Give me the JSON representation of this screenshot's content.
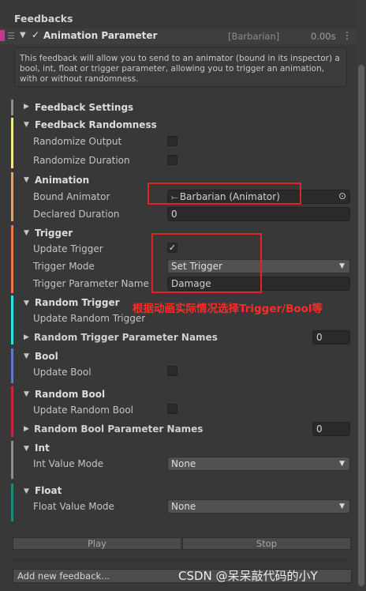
{
  "header": {
    "title": "Feedbacks"
  },
  "feedback": {
    "name": "Animation Parameter",
    "check": "✓",
    "target": "[Barbarian]",
    "time": "0.00s",
    "help": "This feedback will allow you to send to an animator (bound in its inspector) a bool, int, float or trigger parameter, allowing you to trigger an animation, with or without randomness."
  },
  "sections": {
    "feedback_settings": "Feedback Settings",
    "feedback_randomness": {
      "title": "Feedback Randomness",
      "randomize_output": "Randomize Output",
      "randomize_duration": "Randomize Duration"
    },
    "animation": {
      "title": "Animation",
      "bound_animator_label": "Bound Animator",
      "bound_animator_value": "Barbarian (Animator)",
      "declared_duration_label": "Declared Duration",
      "declared_duration_value": "0"
    },
    "trigger": {
      "title": "Trigger",
      "update_trigger_label": "Update Trigger",
      "update_trigger_check": "✓",
      "trigger_mode_label": "Trigger Mode",
      "trigger_mode_value": "Set Trigger",
      "param_name_label": "Trigger Parameter Name",
      "param_name_value": "Damage"
    },
    "random_trigger": {
      "title": "Random Trigger",
      "update_label": "Update Random Trigger",
      "names_label": "Random Trigger Parameter Names",
      "names_count": "0"
    },
    "bool": {
      "title": "Bool",
      "update_label": "Update Bool"
    },
    "random_bool": {
      "title": "Random Bool",
      "update_label": "Update Random Bool",
      "names_label": "Random Bool Parameter Names",
      "names_count": "0"
    },
    "int": {
      "title": "Int",
      "mode_label": "Int Value Mode",
      "mode_value": "None"
    },
    "float": {
      "title": "Float",
      "mode_label": "Float Value Mode",
      "mode_value": "None"
    }
  },
  "annotation": "根据动画实际情况选择Trigger/Bool等",
  "buttons": {
    "play": "Play",
    "stop": "Stop",
    "add_new": "Add new feedback..."
  },
  "watermark": "CSDN @呆呆敲代码的小Y",
  "colors": {
    "feedback_color": "#c0398f",
    "randomness": "#f3e58a",
    "animation": "#e0a276",
    "trigger": "#ea7a4e",
    "random_trigger": "#2fe0e8",
    "bool": "#5f7ac8",
    "random_bool": "#c8283a",
    "int": "#8c8c8c",
    "float": "#1d8a80",
    "annotation": "#ff2a2a"
  }
}
